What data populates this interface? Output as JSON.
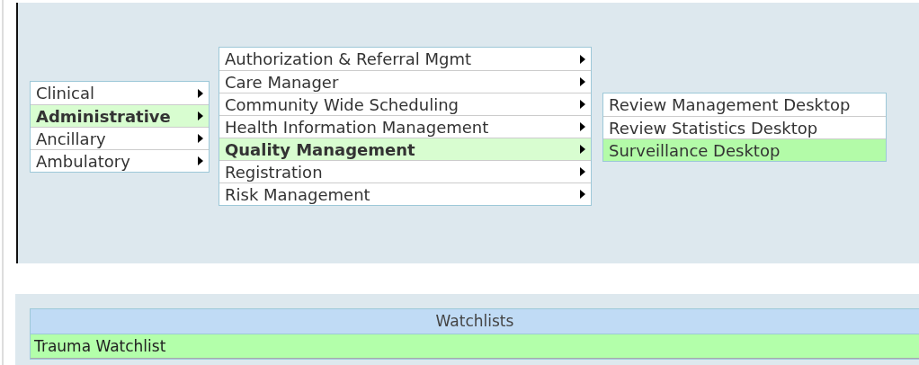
{
  "menus": [
    {
      "items": [
        {
          "label": "Clinical",
          "selected": false,
          "submenu": true
        },
        {
          "label": "Administrative",
          "selected": true,
          "submenu": true
        },
        {
          "label": "Ancillary",
          "selected": false,
          "submenu": true
        },
        {
          "label": "Ambulatory",
          "selected": false,
          "submenu": true
        }
      ]
    },
    {
      "items": [
        {
          "label": "Authorization & Referral Mgmt",
          "selected": false,
          "submenu": true
        },
        {
          "label": "Care Manager",
          "selected": false,
          "submenu": true
        },
        {
          "label": "Community Wide Scheduling",
          "selected": false,
          "submenu": true
        },
        {
          "label": "Health Information Management",
          "selected": false,
          "submenu": true
        },
        {
          "label": "Quality Management",
          "selected": true,
          "submenu": true
        },
        {
          "label": "Registration",
          "selected": false,
          "submenu": true
        },
        {
          "label": "Risk Management",
          "selected": false,
          "submenu": true
        }
      ]
    },
    {
      "items": [
        {
          "label": "Review Management Desktop",
          "selected": false,
          "submenu": false
        },
        {
          "label": "Review Statistics Desktop",
          "selected": false,
          "submenu": false
        },
        {
          "label": "Surveillance Desktop",
          "selected": true,
          "submenu": false
        }
      ]
    }
  ],
  "watchlists": {
    "title": "Watchlists",
    "rows": [
      {
        "label": "Trauma Watchlist",
        "selected": true
      }
    ]
  }
}
